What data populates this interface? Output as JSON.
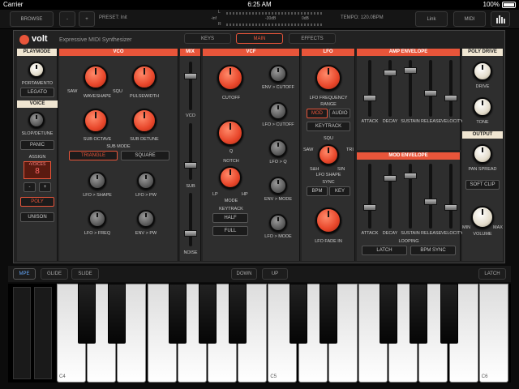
{
  "status": {
    "carrier": "Carrier",
    "time": "6:25 AM",
    "battery": "100%"
  },
  "top": {
    "browse": "BROWSE",
    "minus": "-",
    "plus": "+",
    "preset": "PRESET: Init",
    "tempo": "TEMPO: 120.0BPM",
    "link": "Link",
    "midi": "MIDI",
    "meter_l": "L",
    "meter_r": "R",
    "db1": "-inf",
    "db2": "-30dB",
    "db3": "0dB"
  },
  "header": {
    "title": "Expressive MIDI Synthesizer",
    "logo": "volt",
    "tabs": [
      "KEYS",
      "MAIN",
      "EFFECTS"
    ]
  },
  "playmode": {
    "title": "PLAYMODE",
    "portamento": "PORTAMENTO",
    "legato": "LEGATO"
  },
  "voice": {
    "title": "VOICE",
    "slop": "SLOP/DETUNE",
    "panic": "PANIC",
    "assign": "ASSIGN",
    "voices_label": "•VOICES",
    "voices_val": "8",
    "minus": "-",
    "plus": "+",
    "poly": "POLY",
    "unison": "UNISON"
  },
  "vco": {
    "title": "VCO",
    "waveshape": "WAVESHAPE",
    "pulsewidth": "PULSEWIDTH",
    "saw": "SAW",
    "squ": "SQU",
    "sub_octave": "SUB OCTAVE",
    "sub_detune": "SUB DETUNE",
    "sub_mode": "SUB MODE",
    "triangle": "TRIANGLE",
    "square": "SQUARE",
    "lfo_shape": "LFO > SHAPE",
    "lfo_pw": "LFO > PW",
    "lfo_freq": "LFO > FREQ",
    "env_pw": "ENV > PW"
  },
  "mix": {
    "title": "MIX",
    "vco": "VCO",
    "sub": "SUB",
    "noise": "NOISE"
  },
  "vcf": {
    "title": "VCF",
    "cutoff": "CUTOFF",
    "q": "Q",
    "notch": "NOTCH",
    "mode": "MODE",
    "lp": "LP",
    "hp": "HP",
    "keytrack": "KEYTRACK",
    "half": "HALF",
    "full": "FULL",
    "env_cutoff": "ENV > CUTOFF",
    "lfo_cutoff": "LFO > CUTOFF",
    "lfo_q": "LFO > Q",
    "env_mode": "ENV > MODE",
    "lfo_mode": "LFO > MODE"
  },
  "lfo": {
    "title": "LFO",
    "freq": "LFO FREQUENCY",
    "range": "RANGE",
    "mod": "MOD",
    "audio": "AUDIO",
    "keytrack": "KEYTRACK",
    "shape": "LFO SHAPE",
    "squ": "SQU",
    "saw": "SAW",
    "tri": "TRI",
    "sin": "SIN",
    "sh": "S&H",
    "sync": "SYNC",
    "bpm": "BPM",
    "key": "KEY",
    "fade": "LFO FADE IN"
  },
  "amp": {
    "title": "AMP ENVELOPE",
    "labels": [
      "ATTACK",
      "DECAY",
      "SUSTAIN",
      "RELEASE",
      "VELOCITY"
    ],
    "levels": [
      0.3,
      0.8,
      0.85,
      0.4,
      0.3
    ]
  },
  "modenv": {
    "title": "MOD ENVELOPE",
    "labels": [
      "ATTACK",
      "DECAY",
      "SUSTAIN",
      "RELEASE",
      "VELOCITY"
    ],
    "levels": [
      0.3,
      0.8,
      0.85,
      0.4,
      0.3
    ],
    "looping": "LOOPING",
    "latch": "LATCH",
    "bpm_sync": "BPM SYNC"
  },
  "polydrive": {
    "title": "POLY DRIVE",
    "drive": "DRIVE",
    "tone": "TONE"
  },
  "output": {
    "title": "OUTPUT",
    "pan": "PAN SPREAD",
    "soft_clip": "SOFT CLIP",
    "volume": "VOLUME",
    "min": "MIN",
    "max": "MAX"
  },
  "keysbar": {
    "mpe": "MPE",
    "glide": "GLIDE",
    "slide": "SLIDE",
    "down": "DOWN",
    "up": "UP",
    "latch": "LATCH"
  },
  "keys": {
    "c4": "C4",
    "c5": "C5",
    "c6": "C6"
  }
}
